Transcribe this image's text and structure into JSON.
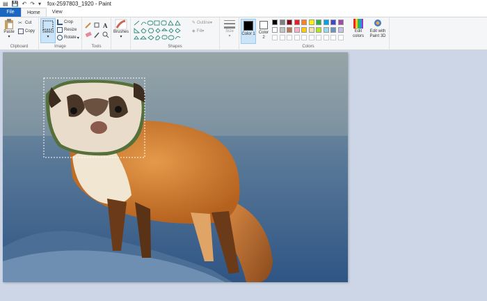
{
  "window": {
    "title": "fox-2597803_1920 - Paint"
  },
  "tabs": {
    "file": "File",
    "home": "Home",
    "view": "View"
  },
  "ribbon": {
    "clipboard": {
      "paste": "Paste",
      "cut": "Cut",
      "copy": "Copy",
      "label": "Clipboard"
    },
    "image": {
      "select": "Select",
      "crop": "Crop",
      "resize": "Resize",
      "rotate": "Rotate",
      "label": "Image"
    },
    "tools": {
      "label": "Tools"
    },
    "brushes": "Brushes",
    "shapes": {
      "outline": "Outline",
      "fill": "Fill",
      "label": "Shapes"
    },
    "size": "Size",
    "color1": "Color 1",
    "color2": "Color 2",
    "colors": {
      "label": "Colors",
      "edit": "Edit colors"
    },
    "paint3d": "Edit with Paint 3D",
    "palette_row1": [
      "#000000",
      "#7f7f7f",
      "#880015",
      "#ed1c24",
      "#ff7f27",
      "#fff200",
      "#22b14c",
      "#00a2e8",
      "#3f48cc",
      "#a349a4"
    ],
    "palette_row2": [
      "#ffffff",
      "#c3c3c3",
      "#b97a57",
      "#ffaec9",
      "#ffc90e",
      "#efe4b0",
      "#b5e61d",
      "#99d9ea",
      "#7092be",
      "#c8bfe7"
    ]
  },
  "colors": {
    "accent": "#1a66c0",
    "canvas_bg": "#ccd6e6"
  }
}
